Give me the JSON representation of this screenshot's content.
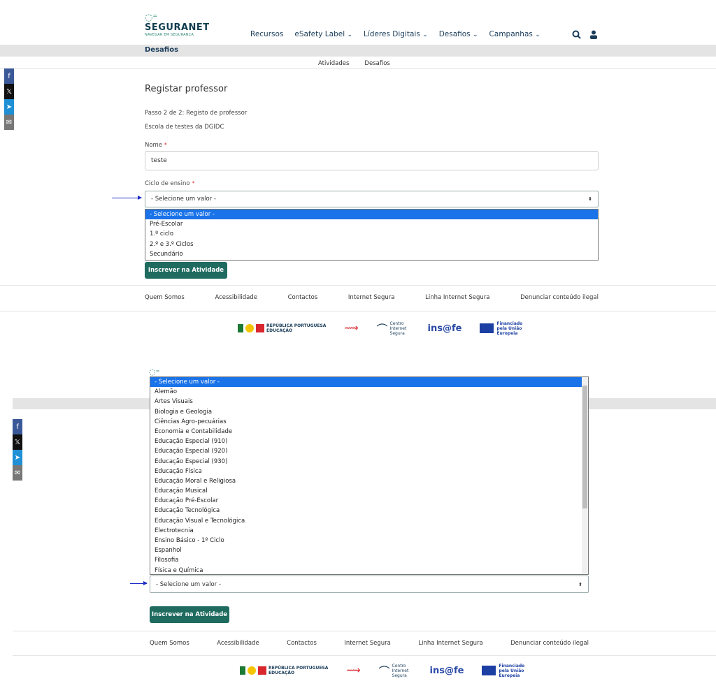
{
  "header": {
    "logo_name": "SEGURANET",
    "logo_tagline": "NAVEGAR EM SEGURANÇA",
    "nav": [
      {
        "label": "Recursos",
        "dropdown": false
      },
      {
        "label": "eSafety Label",
        "dropdown": true
      },
      {
        "label": "Líderes Digitais",
        "dropdown": true
      },
      {
        "label": "Desafios",
        "dropdown": true
      },
      {
        "label": "Campanhas",
        "dropdown": true
      }
    ]
  },
  "breadcrumb": "Desafios",
  "subnav": [
    "Atividades",
    "Desafios"
  ],
  "share_icons": [
    "facebook-icon",
    "x-icon",
    "telegram-icon",
    "email-icon"
  ],
  "form": {
    "title": "Registar professor",
    "step": "Passo 2 de 2: Registo de professor",
    "school": "Escola de testes da DGIDC",
    "name_label": "Nome",
    "name_value": "teste",
    "cycle_label": "Ciclo de ensino",
    "select_placeholder": "- Selecione um valor -",
    "cycle_options": [
      "- Selecione um valor -",
      "Pré-Escolar",
      "1.º ciclo",
      "2.º e 3.º Ciclos",
      "Secundário"
    ],
    "submit_label": "Inscrever na Atividade"
  },
  "subject_options": [
    "- Selecione um valor -",
    "Alemão",
    "Artes Visuais",
    "Biologia e Geologia",
    "Ciências Agro-pecuárias",
    "Economia e Contabilidade",
    "Educação Especial (910)",
    "Educação Especial (920)",
    "Educação Especial (930)",
    "Educação Física",
    "Educação Moral e Religiosa",
    "Educação Musical",
    "Educação Pré-Escolar",
    "Educação Tecnológica",
    "Educação Visual e Tecnológica",
    "Electrotecnia",
    "Ensino Básico - 1º Ciclo",
    "Espanhol",
    "Filosofia",
    "Física e Química"
  ],
  "footer": {
    "links": [
      "Quem Somos",
      "Acessibilidade",
      "Contactos",
      "Internet Segura",
      "Linha Internet Segura",
      "Denunciar conteúdo ilegal"
    ],
    "partner_republica": "REPÚBLICA PORTUGUESA",
    "partner_educacao": "EDUCAÇÃO",
    "partner_centro": "Centro Internet Segura",
    "partner_insafe": "ins@fe",
    "partner_eu": "Financiado pela União Europeia"
  },
  "colors": {
    "accent": "#1f6b5f",
    "selected": "#1a73e8",
    "annotation_arrow": "#1a2bc9"
  }
}
